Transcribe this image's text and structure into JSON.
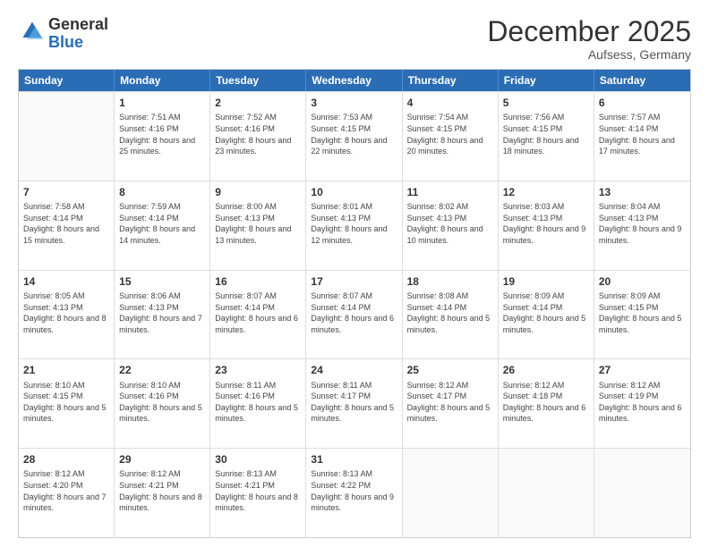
{
  "header": {
    "logo": {
      "general": "General",
      "blue": "Blue"
    },
    "title": "December 2025",
    "location": "Aufsess, Germany"
  },
  "days_of_week": [
    "Sunday",
    "Monday",
    "Tuesday",
    "Wednesday",
    "Thursday",
    "Friday",
    "Saturday"
  ],
  "weeks": [
    [
      {
        "day": "",
        "sunrise": "",
        "sunset": "",
        "daylight": ""
      },
      {
        "day": "1",
        "sunrise": "Sunrise: 7:51 AM",
        "sunset": "Sunset: 4:16 PM",
        "daylight": "Daylight: 8 hours and 25 minutes."
      },
      {
        "day": "2",
        "sunrise": "Sunrise: 7:52 AM",
        "sunset": "Sunset: 4:16 PM",
        "daylight": "Daylight: 8 hours and 23 minutes."
      },
      {
        "day": "3",
        "sunrise": "Sunrise: 7:53 AM",
        "sunset": "Sunset: 4:15 PM",
        "daylight": "Daylight: 8 hours and 22 minutes."
      },
      {
        "day": "4",
        "sunrise": "Sunrise: 7:54 AM",
        "sunset": "Sunset: 4:15 PM",
        "daylight": "Daylight: 8 hours and 20 minutes."
      },
      {
        "day": "5",
        "sunrise": "Sunrise: 7:56 AM",
        "sunset": "Sunset: 4:15 PM",
        "daylight": "Daylight: 8 hours and 18 minutes."
      },
      {
        "day": "6",
        "sunrise": "Sunrise: 7:57 AM",
        "sunset": "Sunset: 4:14 PM",
        "daylight": "Daylight: 8 hours and 17 minutes."
      }
    ],
    [
      {
        "day": "7",
        "sunrise": "Sunrise: 7:58 AM",
        "sunset": "Sunset: 4:14 PM",
        "daylight": "Daylight: 8 hours and 15 minutes."
      },
      {
        "day": "8",
        "sunrise": "Sunrise: 7:59 AM",
        "sunset": "Sunset: 4:14 PM",
        "daylight": "Daylight: 8 hours and 14 minutes."
      },
      {
        "day": "9",
        "sunrise": "Sunrise: 8:00 AM",
        "sunset": "Sunset: 4:13 PM",
        "daylight": "Daylight: 8 hours and 13 minutes."
      },
      {
        "day": "10",
        "sunrise": "Sunrise: 8:01 AM",
        "sunset": "Sunset: 4:13 PM",
        "daylight": "Daylight: 8 hours and 12 minutes."
      },
      {
        "day": "11",
        "sunrise": "Sunrise: 8:02 AM",
        "sunset": "Sunset: 4:13 PM",
        "daylight": "Daylight: 8 hours and 10 minutes."
      },
      {
        "day": "12",
        "sunrise": "Sunrise: 8:03 AM",
        "sunset": "Sunset: 4:13 PM",
        "daylight": "Daylight: 8 hours and 9 minutes."
      },
      {
        "day": "13",
        "sunrise": "Sunrise: 8:04 AM",
        "sunset": "Sunset: 4:13 PM",
        "daylight": "Daylight: 8 hours and 9 minutes."
      }
    ],
    [
      {
        "day": "14",
        "sunrise": "Sunrise: 8:05 AM",
        "sunset": "Sunset: 4:13 PM",
        "daylight": "Daylight: 8 hours and 8 minutes."
      },
      {
        "day": "15",
        "sunrise": "Sunrise: 8:06 AM",
        "sunset": "Sunset: 4:13 PM",
        "daylight": "Daylight: 8 hours and 7 minutes."
      },
      {
        "day": "16",
        "sunrise": "Sunrise: 8:07 AM",
        "sunset": "Sunset: 4:14 PM",
        "daylight": "Daylight: 8 hours and 6 minutes."
      },
      {
        "day": "17",
        "sunrise": "Sunrise: 8:07 AM",
        "sunset": "Sunset: 4:14 PM",
        "daylight": "Daylight: 8 hours and 6 minutes."
      },
      {
        "day": "18",
        "sunrise": "Sunrise: 8:08 AM",
        "sunset": "Sunset: 4:14 PM",
        "daylight": "Daylight: 8 hours and 5 minutes."
      },
      {
        "day": "19",
        "sunrise": "Sunrise: 8:09 AM",
        "sunset": "Sunset: 4:14 PM",
        "daylight": "Daylight: 8 hours and 5 minutes."
      },
      {
        "day": "20",
        "sunrise": "Sunrise: 8:09 AM",
        "sunset": "Sunset: 4:15 PM",
        "daylight": "Daylight: 8 hours and 5 minutes."
      }
    ],
    [
      {
        "day": "21",
        "sunrise": "Sunrise: 8:10 AM",
        "sunset": "Sunset: 4:15 PM",
        "daylight": "Daylight: 8 hours and 5 minutes."
      },
      {
        "day": "22",
        "sunrise": "Sunrise: 8:10 AM",
        "sunset": "Sunset: 4:16 PM",
        "daylight": "Daylight: 8 hours and 5 minutes."
      },
      {
        "day": "23",
        "sunrise": "Sunrise: 8:11 AM",
        "sunset": "Sunset: 4:16 PM",
        "daylight": "Daylight: 8 hours and 5 minutes."
      },
      {
        "day": "24",
        "sunrise": "Sunrise: 8:11 AM",
        "sunset": "Sunset: 4:17 PM",
        "daylight": "Daylight: 8 hours and 5 minutes."
      },
      {
        "day": "25",
        "sunrise": "Sunrise: 8:12 AM",
        "sunset": "Sunset: 4:17 PM",
        "daylight": "Daylight: 8 hours and 5 minutes."
      },
      {
        "day": "26",
        "sunrise": "Sunrise: 8:12 AM",
        "sunset": "Sunset: 4:18 PM",
        "daylight": "Daylight: 8 hours and 6 minutes."
      },
      {
        "day": "27",
        "sunrise": "Sunrise: 8:12 AM",
        "sunset": "Sunset: 4:19 PM",
        "daylight": "Daylight: 8 hours and 6 minutes."
      }
    ],
    [
      {
        "day": "28",
        "sunrise": "Sunrise: 8:12 AM",
        "sunset": "Sunset: 4:20 PM",
        "daylight": "Daylight: 8 hours and 7 minutes."
      },
      {
        "day": "29",
        "sunrise": "Sunrise: 8:12 AM",
        "sunset": "Sunset: 4:21 PM",
        "daylight": "Daylight: 8 hours and 8 minutes."
      },
      {
        "day": "30",
        "sunrise": "Sunrise: 8:13 AM",
        "sunset": "Sunset: 4:21 PM",
        "daylight": "Daylight: 8 hours and 8 minutes."
      },
      {
        "day": "31",
        "sunrise": "Sunrise: 8:13 AM",
        "sunset": "Sunset: 4:22 PM",
        "daylight": "Daylight: 8 hours and 9 minutes."
      },
      {
        "day": "",
        "sunrise": "",
        "sunset": "",
        "daylight": ""
      },
      {
        "day": "",
        "sunrise": "",
        "sunset": "",
        "daylight": ""
      },
      {
        "day": "",
        "sunrise": "",
        "sunset": "",
        "daylight": ""
      }
    ]
  ]
}
